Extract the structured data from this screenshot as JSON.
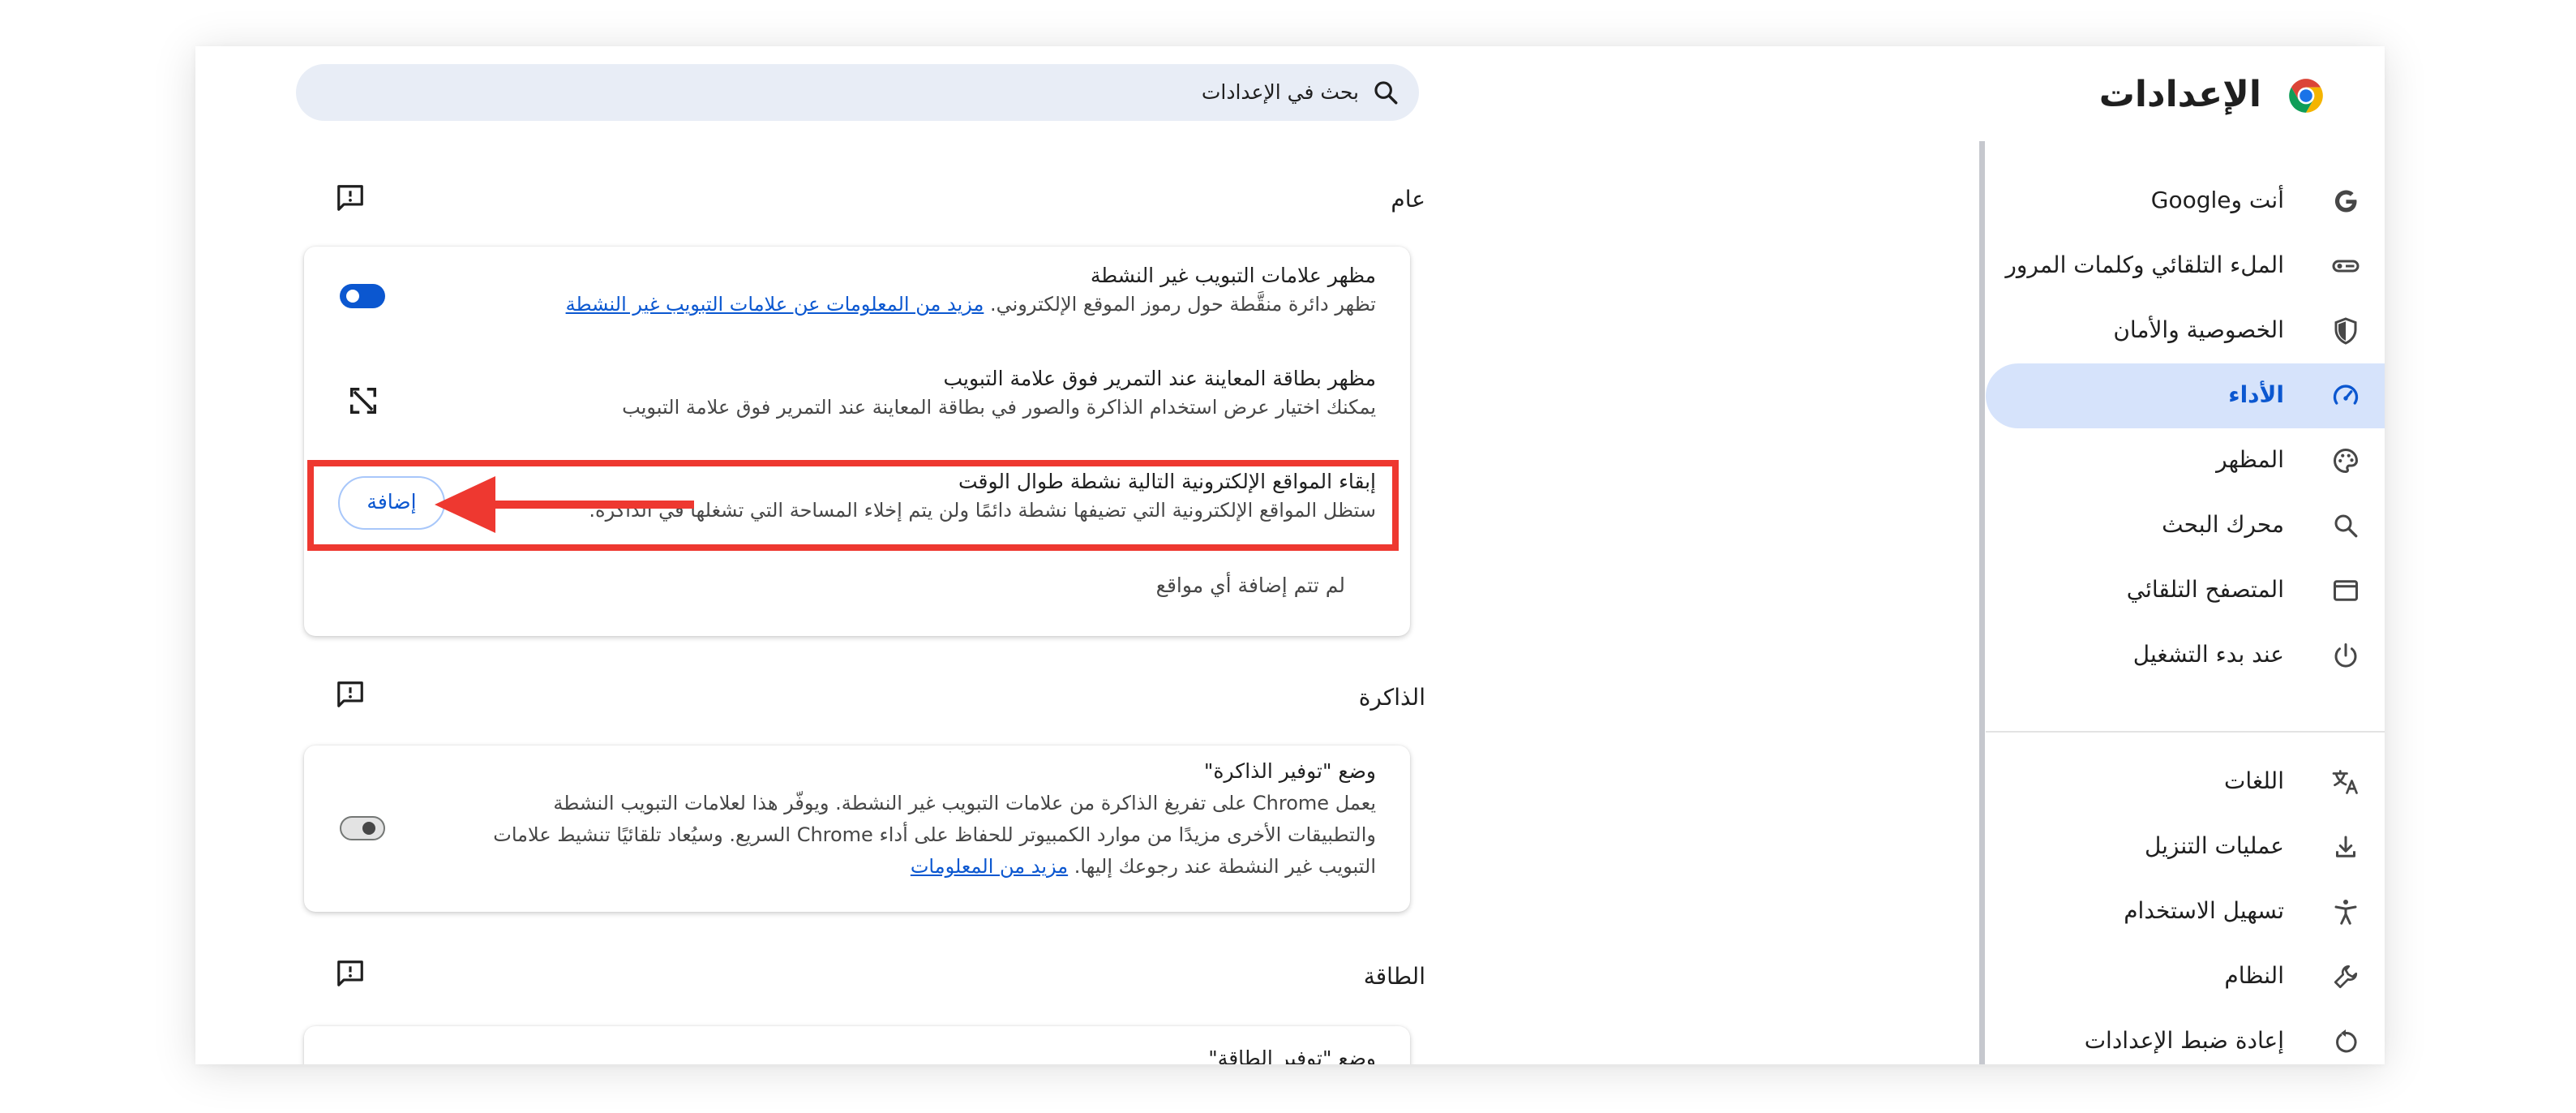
{
  "header": {
    "title": "الإعدادات",
    "search_placeholder": "بحث في الإعدادات"
  },
  "sidebar": {
    "items": [
      {
        "label": "أنت وGoogle",
        "icon": "google-icon"
      },
      {
        "label": "الملء التلقائي وكلمات المرور",
        "icon": "key-icon"
      },
      {
        "label": "الخصوصية والأمان",
        "icon": "shield-icon"
      },
      {
        "label": "الأداء",
        "icon": "speedometer-icon",
        "active": true
      },
      {
        "label": "المظهر",
        "icon": "palette-icon"
      },
      {
        "label": "محرك البحث",
        "icon": "search-icon"
      },
      {
        "label": "المتصفح التلقائي",
        "icon": "browser-icon"
      },
      {
        "label": "عند بدء التشغيل",
        "icon": "power-icon"
      },
      {
        "label": "اللغات",
        "icon": "translate-icon"
      },
      {
        "label": "عمليات التنزيل",
        "icon": "download-icon"
      },
      {
        "label": "تسهيل الاستخدام",
        "icon": "accessibility-icon"
      },
      {
        "label": "النظام",
        "icon": "wrench-icon"
      },
      {
        "label": "إعادة ضبط الإعدادات",
        "icon": "reset-icon"
      }
    ]
  },
  "sections": {
    "general": {
      "title": "عام",
      "inactive_tabs": {
        "title": "مظهر علامات التبويب غير النشطة",
        "desc": "تظهر دائرة منقَّطة حول رموز الموقع الإلكتروني.",
        "link": "مزيد من المعلومات عن علامات التبويب غير النشطة",
        "enabled": true
      },
      "hover_preview": {
        "title": "مظهر بطاقة المعاينة عند التمرير فوق علامة التبويب",
        "desc": "يمكنك اختيار عرض استخدام الذاكرة والصور في بطاقة المعاينة عند التمرير فوق علامة التبويب"
      },
      "always_active": {
        "title": "إبقاء المواقع الإلكترونية التالية نشطة طوال الوقت",
        "desc": "ستظل المواقع الإلكترونية التي تضيفها نشطة دائمًا ولن يتم إخلاء المساحة التي تشغلها في الذاكرة.",
        "button": "إضافة",
        "empty": "لم تتم إضافة أي مواقع"
      }
    },
    "memory": {
      "title": "الذاكرة",
      "saver_title": "وضع \"توفير الذاكرة\"",
      "saver_line1": "يعمل Chrome على تفريغ الذاكرة من علامات التبويب غير النشطة. ويوفّر هذا لعلامات التبويب النشطة",
      "saver_line2": "والتطبيقات الأخرى مزيدًا من موارد الكمبيوتر للحفاظ على أداء Chrome السريع. وسيُعاد تلقائيًا تنشيط علامات",
      "saver_line3": "التبويب غير النشطة عند رجوعك إليها.",
      "saver_link": "مزيد من المعلومات",
      "enabled": false
    },
    "energy": {
      "title": "الطاقة",
      "saver_title": "وضع \"توفير الطاقة\""
    }
  },
  "colors": {
    "accent": "#0b57d0",
    "active_nav_bg": "#d6e3fb",
    "annotation": "#ee3830"
  }
}
